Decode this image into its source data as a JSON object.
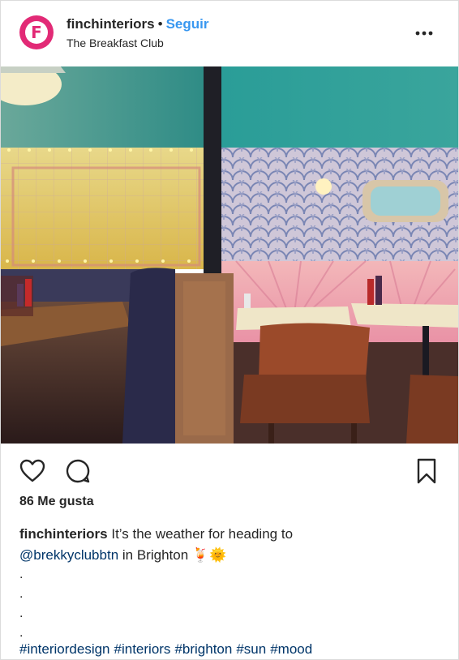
{
  "header": {
    "avatar_letter": "F",
    "username": "finchinteriors",
    "separator": "•",
    "follow_label": "Seguir",
    "location": "The Breakfast Club",
    "more_icon": "more-horizontal-icon"
  },
  "photo": {
    "icon": "photo-image"
  },
  "actions": {
    "like_icon": "heart-icon",
    "comment_icon": "comment-icon",
    "save_icon": "bookmark-icon"
  },
  "likes_text": "86 Me gusta",
  "caption": {
    "username": "finchinteriors",
    "text_part1": "It’s the weather for heading to",
    "mention": "@brekkyclubbtn",
    "text_part2": "in Brighton",
    "emoji": "🍹🌞",
    "dots": [
      ".",
      ".",
      ".",
      "."
    ],
    "hashtags": [
      "#interiordesign",
      "#interiors",
      "#brighton",
      "#sun",
      "#mood"
    ]
  },
  "colors": {
    "brand": "#e22a76",
    "follow": "#3897f0",
    "link": "#003569"
  }
}
